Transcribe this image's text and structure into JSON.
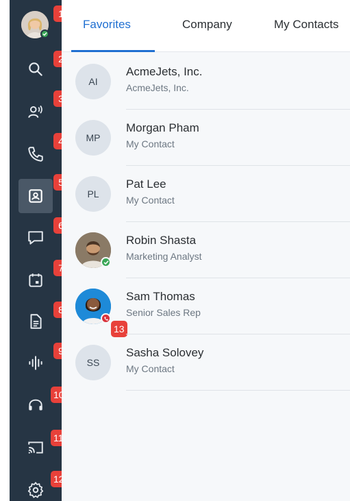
{
  "tabs": [
    {
      "label": "Favorites",
      "active": true
    },
    {
      "label": "Company",
      "active": false
    },
    {
      "label": "My Contacts",
      "active": false
    }
  ],
  "sidebar": {
    "items": [
      {
        "icon": "user-avatar",
        "badge": "1"
      },
      {
        "icon": "search-icon",
        "badge": "2"
      },
      {
        "icon": "people-talk-icon",
        "badge": "3"
      },
      {
        "icon": "phone-icon",
        "badge": "4"
      },
      {
        "icon": "contacts-icon",
        "badge": "5",
        "active": true
      },
      {
        "icon": "chat-icon",
        "badge": "6"
      },
      {
        "icon": "calendar-icon",
        "badge": "7"
      },
      {
        "icon": "document-icon",
        "badge": "8"
      },
      {
        "icon": "waveform-icon",
        "badge": "9"
      },
      {
        "icon": "headset-icon",
        "badge": "10"
      },
      {
        "icon": "cast-icon",
        "badge": "11"
      },
      {
        "icon": "gear-icon",
        "badge": "12"
      }
    ]
  },
  "contacts": [
    {
      "initials": "AI",
      "name": "AcmeJets, Inc.",
      "subtitle": "AcmeJets, Inc."
    },
    {
      "initials": "MP",
      "name": "Morgan Pham",
      "subtitle": "My Contact"
    },
    {
      "initials": "PL",
      "name": "Pat Lee",
      "subtitle": "My Contact"
    },
    {
      "initials": "",
      "name": "Robin Shasta",
      "subtitle": "Marketing Analyst",
      "presence": "available"
    },
    {
      "initials": "",
      "name": "Sam Thomas",
      "subtitle": "Senior Sales Rep",
      "presence": "on-call",
      "badge": "13"
    },
    {
      "initials": "SS",
      "name": "Sasha Solovey",
      "subtitle": "My Contact"
    }
  ],
  "colors": {
    "sidebar_bg": "#263544",
    "accent": "#1f6fd1",
    "badge": "#e8413a",
    "available": "#3aa757",
    "busy": "#d9323b"
  }
}
